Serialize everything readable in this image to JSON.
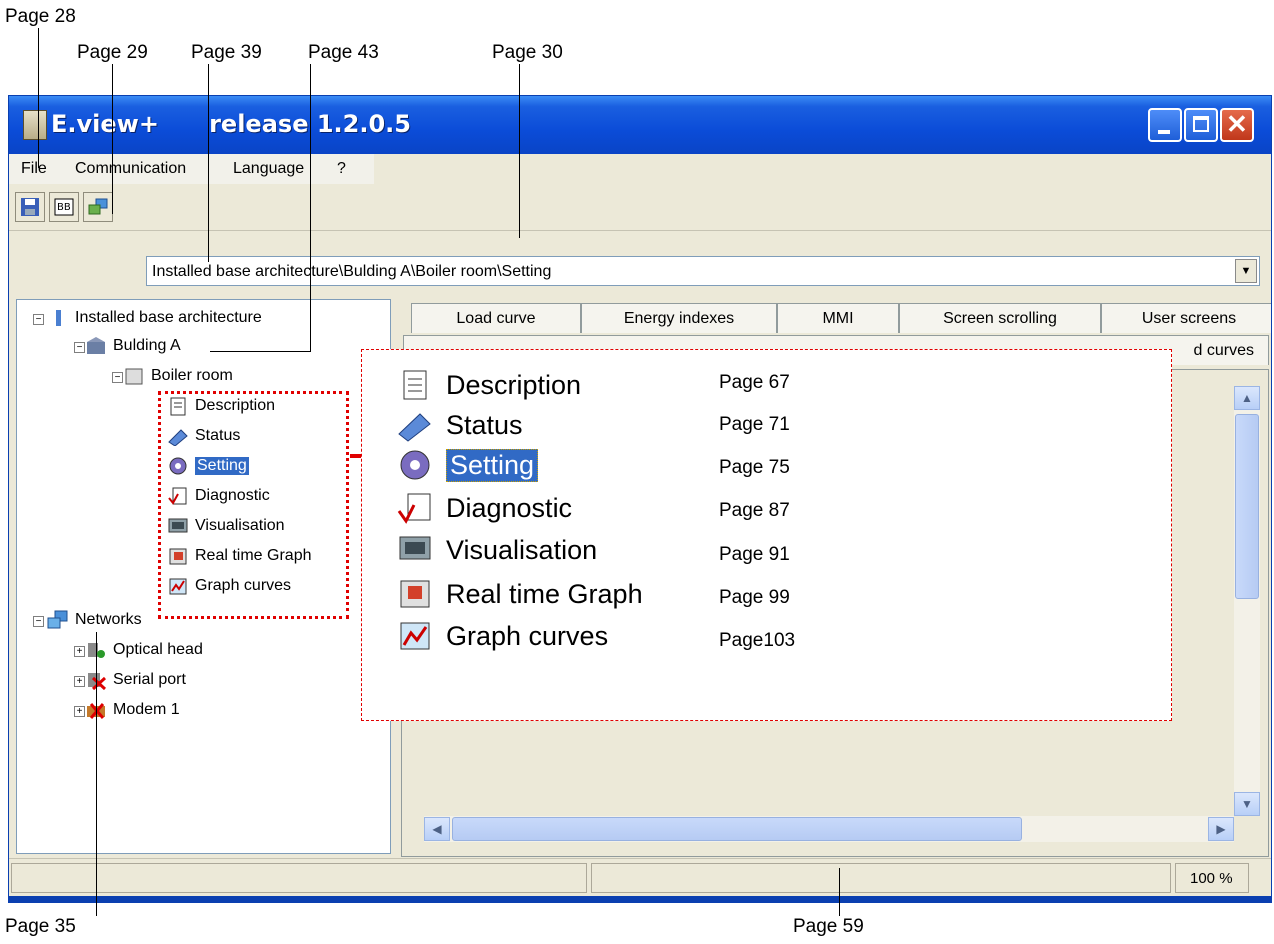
{
  "callouts": {
    "p28": "Page 28",
    "p29": "Page 29",
    "p39": "Page 39",
    "p43": "Page 43",
    "p30": "Page 30",
    "p35": "Page 35",
    "p59": "Page 59"
  },
  "window": {
    "title": "E.view+",
    "release": "release 1.2.0.5"
  },
  "menu": [
    "File",
    "Communication",
    "Language",
    "?"
  ],
  "address": {
    "value": "Installed base architecture\\Bulding A\\Boiler room\\Setting"
  },
  "tree": {
    "root": "Installed base architecture",
    "building": "Bulding A",
    "room": "Boiler room",
    "items": [
      "Description",
      "Status",
      "Setting",
      "Diagnostic",
      "Visualisation",
      "Real time Graph",
      "Graph curves"
    ],
    "networks": "Networks",
    "network_items": [
      "Optical head",
      "Serial port",
      "Modem 1"
    ]
  },
  "tabs_row1": [
    "Load curve",
    "Energy indexes",
    "MMI",
    "Screen scrolling",
    "User screens"
  ],
  "tabs_row2_last": "d curves",
  "statusbar": {
    "zoom": "100 %"
  },
  "zoom_panel": {
    "items": [
      "Description",
      "Status",
      "Setting",
      "Diagnostic",
      "Visualisation",
      "Real time Graph",
      "Graph curves"
    ],
    "pages": [
      "Page 67",
      "Page 71",
      "Page 75",
      "Page 87",
      "Page 91",
      "Page 99",
      "Page103"
    ]
  },
  "colors": {
    "titlebar": "#0b4cd8",
    "selection": "#316ac5",
    "highlight_border": "#e00000"
  }
}
